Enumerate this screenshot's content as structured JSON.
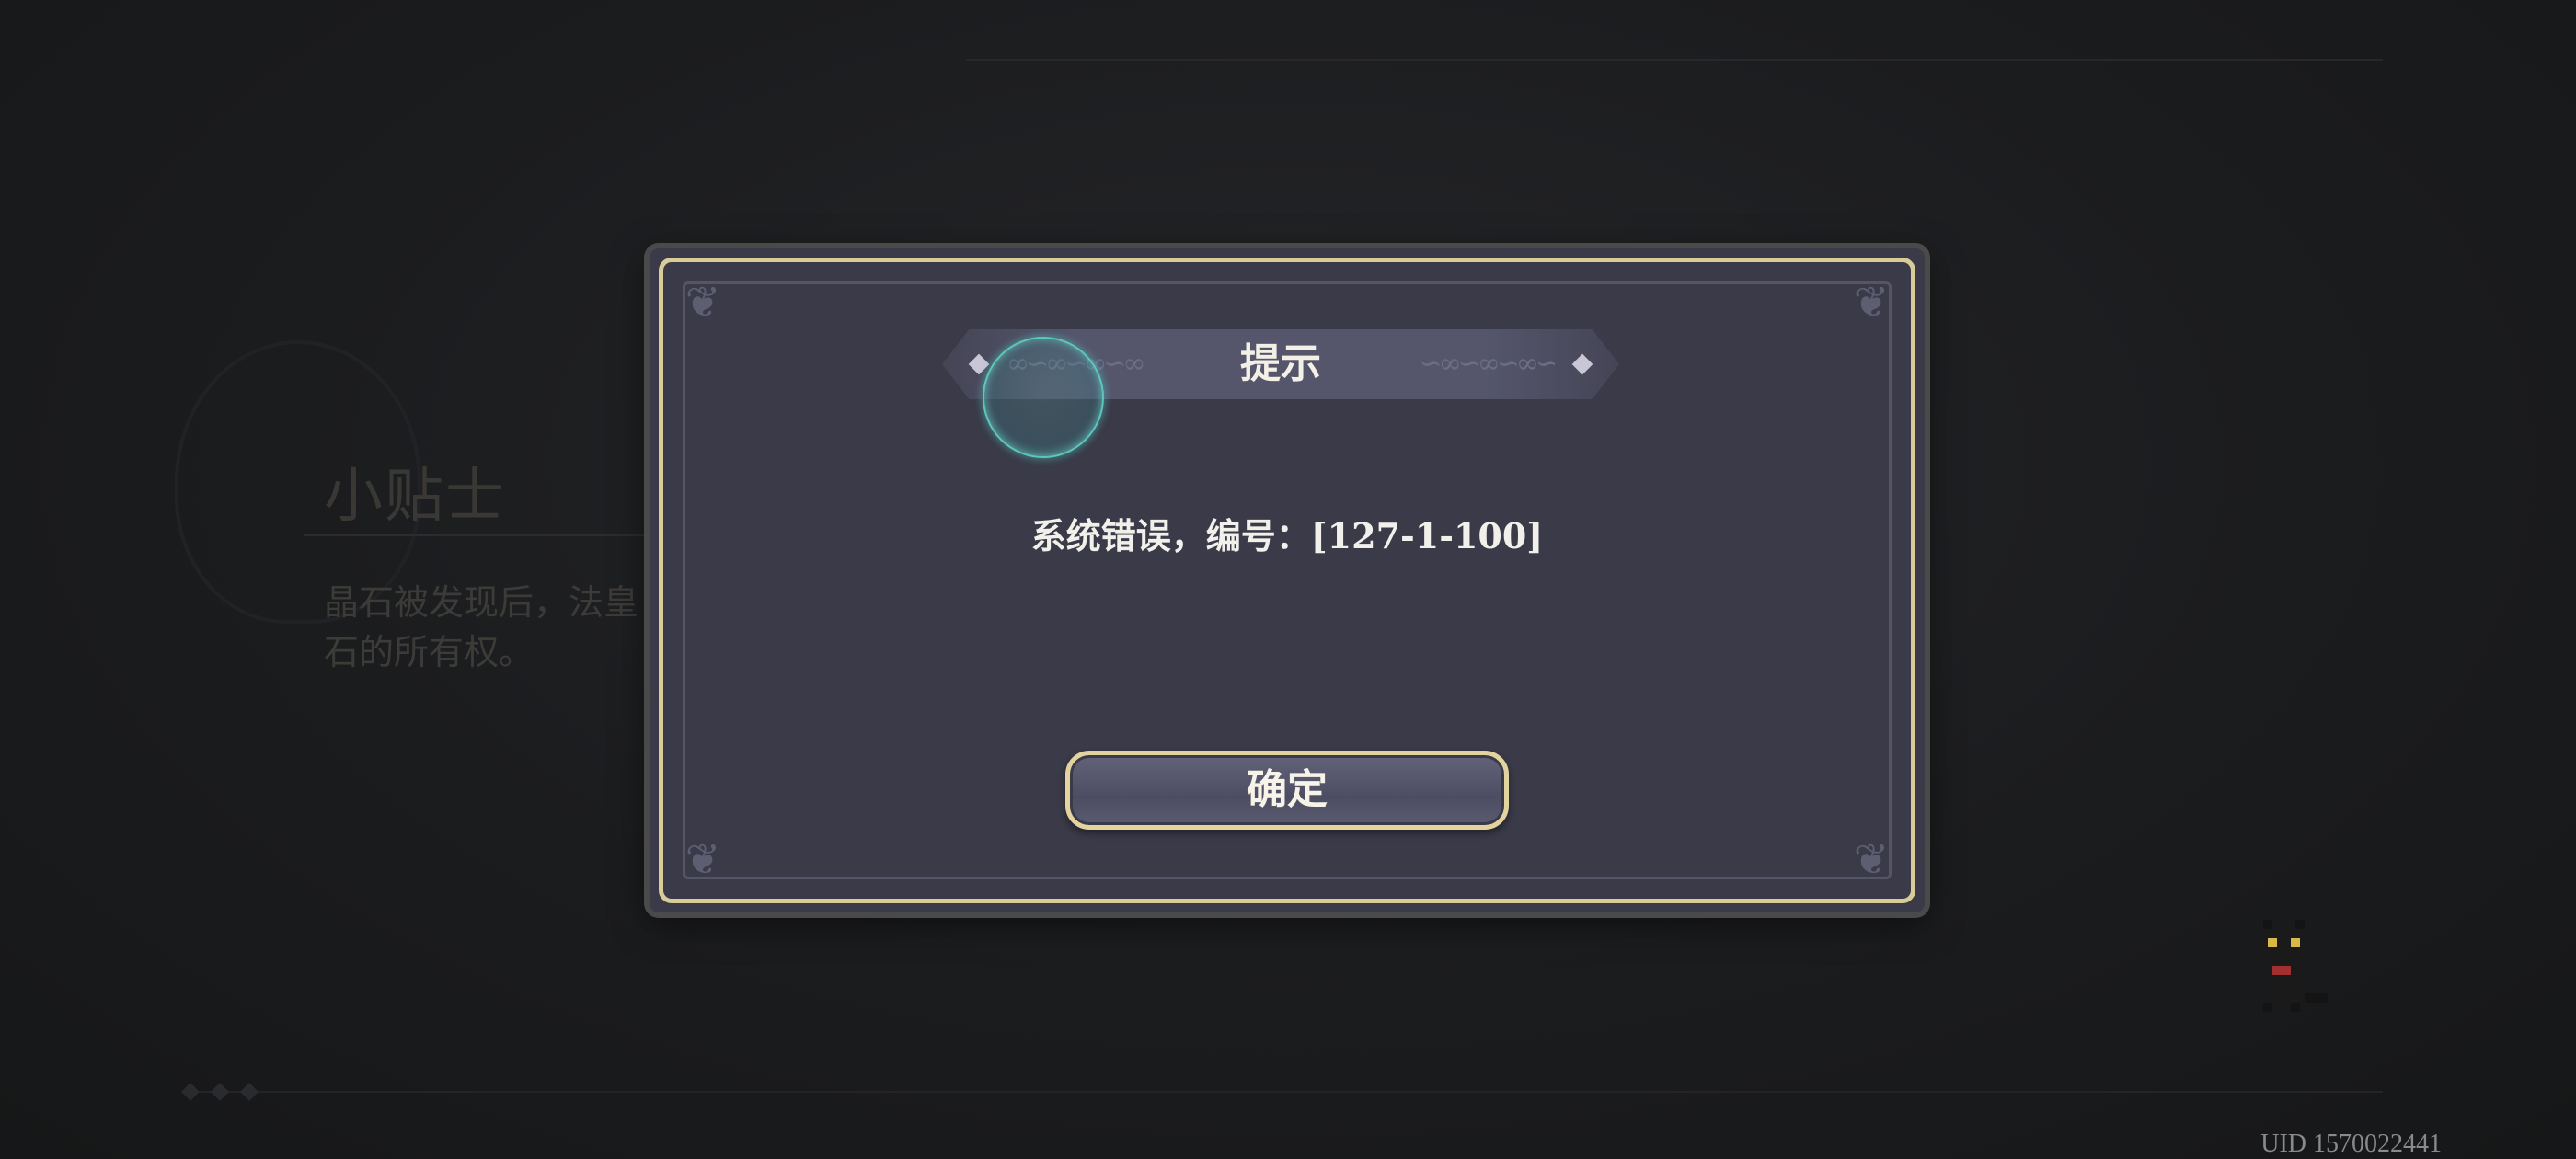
{
  "background": {
    "tips_title": "小贴士",
    "tips_body": "晶石被发现后，法皇\n石的所有权。"
  },
  "dialog": {
    "title": "提示",
    "message": "系统错误，编号：[127-1-100]",
    "confirm_label": "确定"
  },
  "footer": {
    "uid": "UID 1570022441"
  },
  "colors": {
    "dialog_bg": "#3a3a48",
    "gold_border": "#d9cc98",
    "orb_teal": "#5ec7bd"
  },
  "icons": {
    "corner": "ornament-corner-icon",
    "orb": "teal-orb-icon",
    "pet": "black-cat-pet-icon"
  }
}
